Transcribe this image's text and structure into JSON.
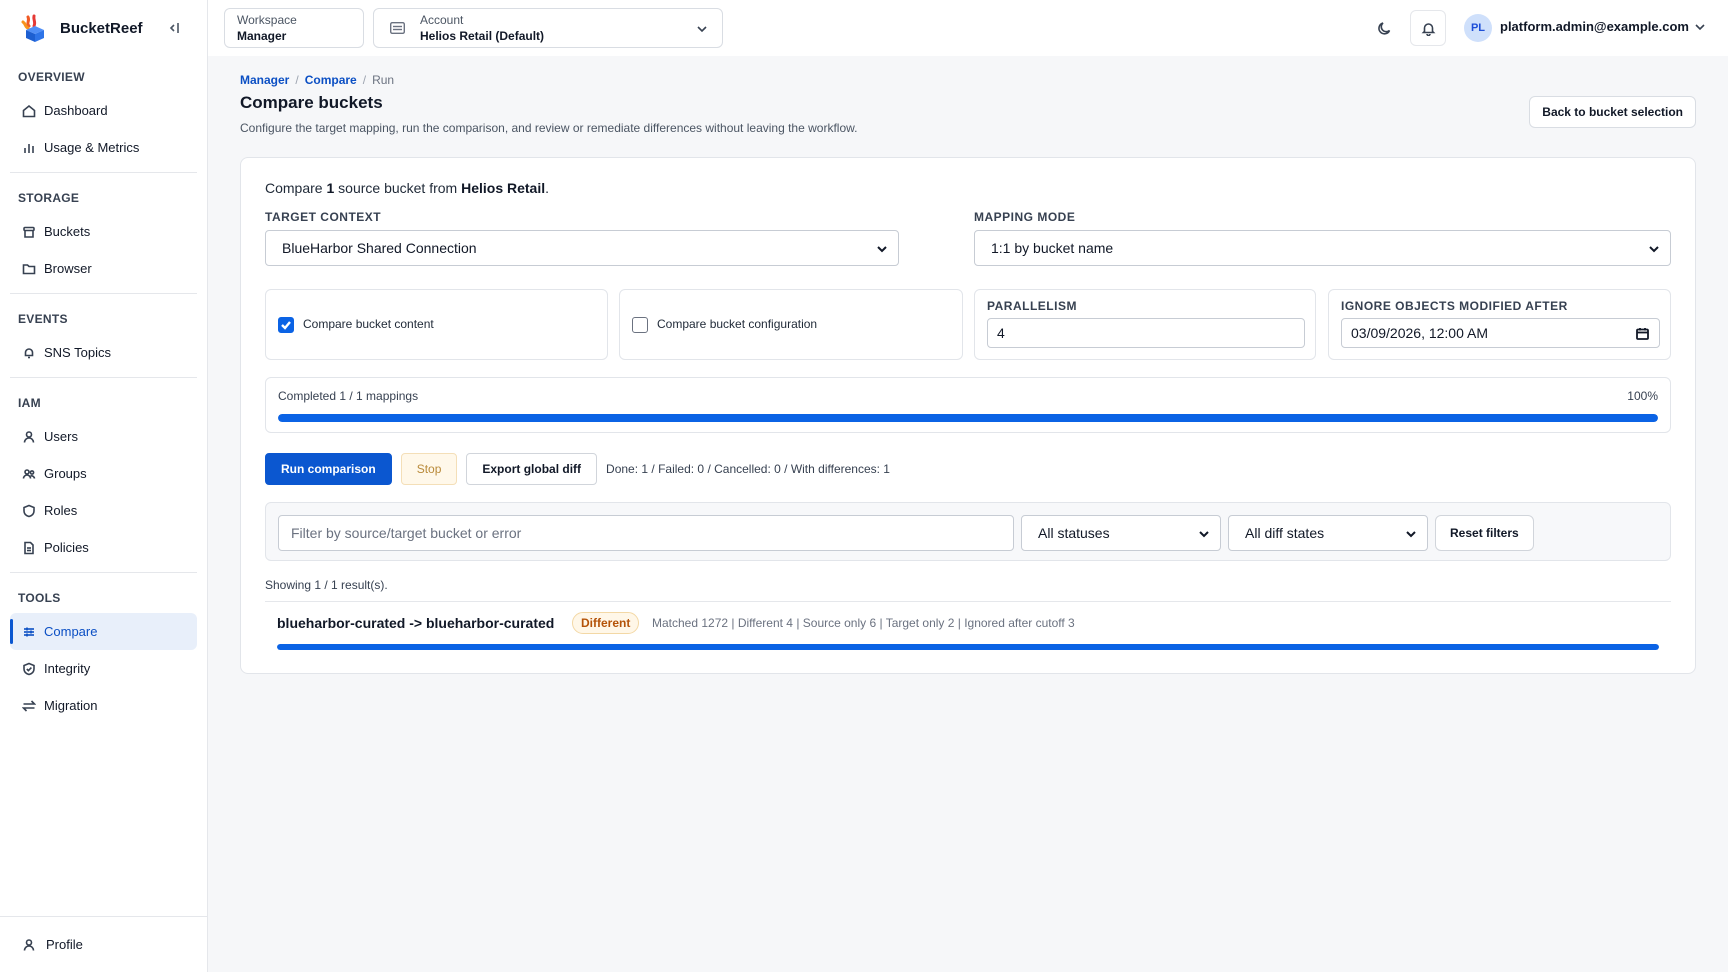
{
  "app": {
    "name": "BucketReef"
  },
  "sidebar": {
    "sections": [
      {
        "title": "OVERVIEW",
        "items": [
          {
            "label": "Dashboard",
            "icon": "home-icon"
          },
          {
            "label": "Usage & Metrics",
            "icon": "bar-chart-icon"
          }
        ]
      },
      {
        "title": "STORAGE",
        "items": [
          {
            "label": "Buckets",
            "icon": "bucket-icon"
          },
          {
            "label": "Browser",
            "icon": "folder-icon"
          }
        ]
      },
      {
        "title": "EVENTS",
        "items": [
          {
            "label": "SNS Topics",
            "icon": "bell-icon"
          }
        ]
      },
      {
        "title": "IAM",
        "items": [
          {
            "label": "Users",
            "icon": "user-icon"
          },
          {
            "label": "Groups",
            "icon": "users-icon"
          },
          {
            "label": "Roles",
            "icon": "shield-icon"
          },
          {
            "label": "Policies",
            "icon": "file-icon"
          }
        ]
      },
      {
        "title": "TOOLS",
        "items": [
          {
            "label": "Compare",
            "icon": "compare-icon",
            "active": true
          },
          {
            "label": "Integrity",
            "icon": "shield-check-icon"
          },
          {
            "label": "Migration",
            "icon": "migration-icon"
          }
        ]
      }
    ],
    "footer": {
      "label": "Profile",
      "icon": "user-icon"
    }
  },
  "header": {
    "workspace": {
      "label": "Workspace",
      "value": "Manager"
    },
    "account": {
      "label": "Account",
      "value": "Helios Retail (Default)"
    },
    "user": {
      "initials": "PL",
      "email": "platform.admin@example.com"
    }
  },
  "breadcrumb": {
    "items": [
      "Manager",
      "Compare",
      "Run"
    ],
    "separator": "/"
  },
  "page": {
    "title": "Compare buckets",
    "subtitle": "Configure the target mapping, run the comparison, and review or remediate differences without leaving the workflow.",
    "back_button": "Back to bucket selection"
  },
  "compare": {
    "intro": {
      "prefix": "Compare ",
      "count": "1",
      "middle": " source bucket from ",
      "account": "Helios Retail",
      "suffix": "."
    },
    "target_context": {
      "label": "TARGET CONTEXT",
      "value": "BlueHarbor Shared Connection"
    },
    "mapping_mode": {
      "label": "MAPPING MODE",
      "value": "1:1 by bucket name"
    },
    "options": {
      "content": {
        "label": "Compare bucket content",
        "checked": true
      },
      "configuration": {
        "label": "Compare bucket configuration",
        "checked": false
      }
    },
    "parallelism": {
      "label": "PARALLELISM",
      "value": "4"
    },
    "ignore_after": {
      "label": "IGNORE OBJECTS MODIFIED AFTER",
      "value": "03/09/2026, 12:00 AM"
    },
    "progress": {
      "text": "Completed 1 / 1 mappings",
      "percent_label": "100%",
      "fraction": 1.0
    },
    "actions": {
      "run": "Run comparison",
      "stop": "Stop",
      "export": "Export global diff"
    },
    "summary": "Done: 1 / Failed: 0 / Cancelled: 0 / With differences: 1",
    "filters": {
      "search_placeholder": "Filter by source/target bucket or error",
      "status": "All statuses",
      "diff": "All diff states",
      "reset": "Reset filters"
    },
    "showing": "Showing 1 / 1 result(s).",
    "results": [
      {
        "name": "blueharbor-curated -> blueharbor-curated",
        "status": "Different",
        "stats": "Matched 1272 | Different 4 | Source only 6 | Target only 2 | Ignored after cutoff 3",
        "progress": 1.0
      }
    ]
  },
  "colors": {
    "accent": "#0b57d0",
    "active_bg": "#e8effa",
    "warn": "#b45309"
  }
}
